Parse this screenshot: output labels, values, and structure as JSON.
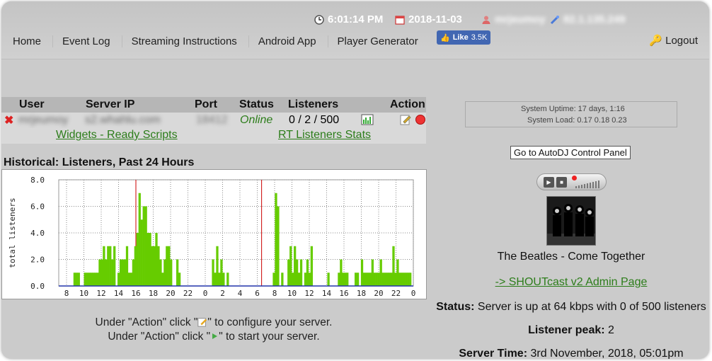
{
  "header": {
    "time": "6:01:14 PM",
    "date": "2018-11-03",
    "username": "mrjeumoy",
    "ip": "82.1.135.249"
  },
  "nav": {
    "items": [
      "Home",
      "Event Log",
      "Streaming Instructions",
      "Android App",
      "Player Generator"
    ],
    "fb_like": "Like",
    "fb_count": "3.5K",
    "logout": "Logout"
  },
  "table": {
    "headers": [
      "User",
      "Server IP",
      "Port",
      "Status",
      "Listeners",
      "Action"
    ],
    "row": {
      "user": "mrjeumoy",
      "server_ip": "s2.whahlu.com",
      "port": "18412",
      "status": "Online",
      "listeners": "0 / 2 / 500"
    },
    "link_widgets": "Widgets - Ready Scripts",
    "link_rt": "RT Listeners Stats"
  },
  "history": {
    "title": "Historical: Listeners, Past 24 Hours"
  },
  "chart_data": {
    "type": "bar",
    "ylabel": "total listeners",
    "ylim": [
      0,
      8
    ],
    "yticks": [
      "8.0",
      "6.0",
      "4.0",
      "2.0",
      "0.0"
    ],
    "xticks": [
      "8",
      "10",
      "12",
      "14",
      "16",
      "18",
      "20",
      "22",
      "0",
      "2",
      "4",
      "6",
      "8",
      "10",
      "12",
      "14",
      "16",
      "18",
      "20",
      "22",
      "0"
    ],
    "values": [
      0,
      0,
      0,
      0,
      0,
      0,
      0,
      1,
      1,
      1,
      0,
      0,
      1,
      1,
      1,
      1,
      1,
      1,
      1,
      2,
      2,
      3,
      2,
      3,
      3,
      2,
      3,
      0,
      1,
      2,
      2,
      2,
      3,
      1,
      1,
      2,
      3,
      4,
      7,
      5,
      6,
      6,
      4,
      4,
      3,
      3,
      4,
      3,
      2,
      1,
      2,
      3,
      3,
      2,
      0,
      0,
      2,
      1,
      0,
      0,
      0,
      0,
      0,
      0,
      0,
      0,
      0,
      0,
      0,
      0,
      0,
      0,
      0,
      2,
      1,
      3,
      1,
      2,
      1,
      0,
      1,
      0,
      0,
      0,
      0,
      0,
      0,
      0,
      0,
      0,
      0,
      0,
      0,
      0,
      0,
      0,
      0,
      0,
      0,
      0,
      0,
      0,
      1,
      7,
      6,
      0,
      1,
      0,
      0,
      2,
      3,
      1,
      3,
      2,
      1,
      2,
      0,
      1,
      2,
      1,
      3,
      0,
      0,
      0,
      0,
      0,
      0,
      0,
      1,
      0,
      0,
      0,
      0,
      1,
      2,
      1,
      1,
      1,
      0,
      0,
      0,
      1,
      1,
      0,
      2,
      1,
      1,
      1,
      1,
      2,
      1,
      1,
      1,
      2,
      1,
      1,
      1,
      1,
      1,
      3,
      1,
      2,
      1,
      1,
      1,
      1,
      1,
      1,
      0
    ],
    "markers_red": [
      8,
      22.5
    ],
    "grid": true
  },
  "hints": {
    "configure_pre": "Under \"Action\" click \"",
    "configure_post": "\" to configure your server.",
    "start_pre": "Under \"Action\" click \"",
    "start_post": "\" to start your server."
  },
  "system": {
    "uptime": "System Uptime: 17 days, 1:16",
    "load": "System Load: 0.17 0.18 0.23"
  },
  "autodj_button": "Go to AutoDJ Control Panel",
  "now_playing": "The Beatles - Come Together",
  "admin_link": "-> SHOUTcast v2 Admin Page",
  "status": {
    "label": "Status:",
    "text": "Server is up at 64 kbps with 0 of 500 listeners"
  },
  "peak": {
    "label": "Listener peak:",
    "value": "2"
  },
  "server_time": {
    "label": "Server Time:",
    "value": "3rd November, 2018, 05:01pm"
  },
  "colors": {
    "bar": "#66cc00",
    "online": "#2c7d1a",
    "marker": "#cc0000"
  }
}
